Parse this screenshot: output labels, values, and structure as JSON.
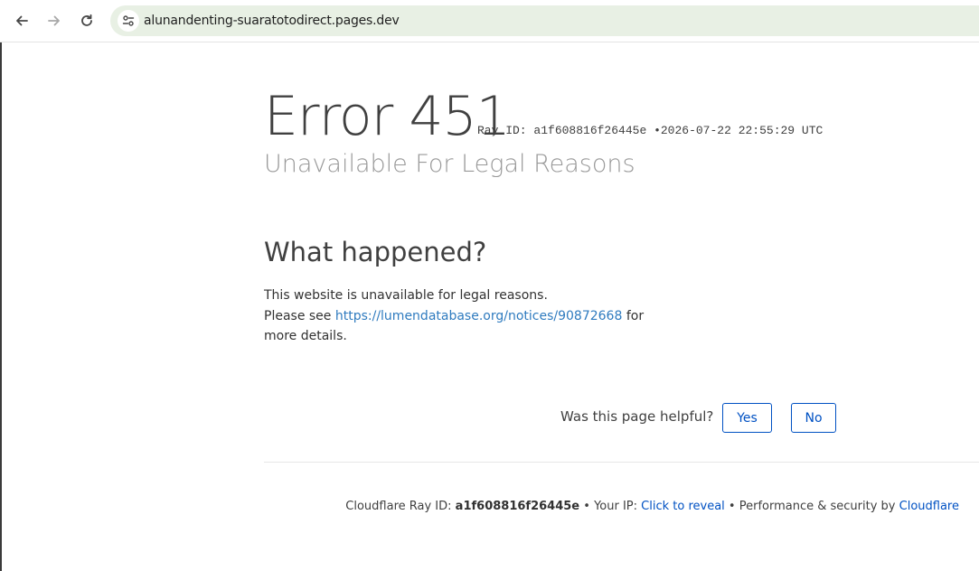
{
  "browser": {
    "url": "alunandenting-suaratotodirect.pages.dev",
    "icons": [
      "back-arrow-icon",
      "forward-arrow-icon",
      "reload-icon",
      "site-settings-icon"
    ]
  },
  "error": {
    "title": "Error 451",
    "ray_label": "Ray ID:",
    "ray_id": "a1f608816f26445e",
    "bullet": "•",
    "timestamp": "2026-07-22 22:55:29 UTC",
    "subtitle": "Unavailable For Legal Reasons"
  },
  "what_happened": {
    "heading": "What happened?",
    "line1": "This website is unavailable for legal reasons.",
    "line2_prefix": "Please see",
    "link": "https://lumendatabase.org/notices/90872668",
    "line2_suffix": "for more details."
  },
  "feedback": {
    "question": "Was this page helpful?",
    "yes": "Yes",
    "no": "No"
  },
  "footer": {
    "ray_label": "Cloudflare Ray ID:",
    "ray_id": "a1f608816f26445e",
    "sep1": "•",
    "ip_label": "Your IP:",
    "ip_link": "Click to reveal",
    "sep2": "•",
    "perf_label": "Performance & security by",
    "cf_link": "Cloudflare"
  },
  "colors": {
    "link": "#2f7bbf",
    "button_border": "#0051c3",
    "omnibox_bg": "#e8f0e4"
  }
}
